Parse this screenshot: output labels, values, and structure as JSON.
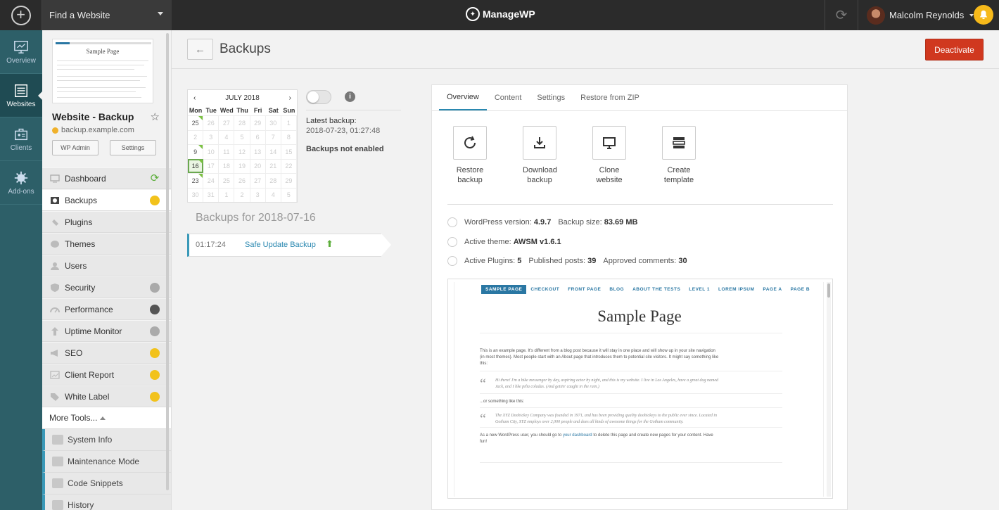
{
  "topbar": {
    "find_website": "Find a Website",
    "logo_text": "ManageWP",
    "user_name": "Malcolm Reynolds"
  },
  "leftnav": [
    {
      "label": "Overview",
      "icon": "monitor-icon"
    },
    {
      "label": "Websites",
      "icon": "websites-icon"
    },
    {
      "label": "Clients",
      "icon": "clients-icon"
    },
    {
      "label": "Add-ons",
      "icon": "addons-icon"
    }
  ],
  "site": {
    "thumb_title": "Sample Page",
    "name": "Website - Backup",
    "url": "backup.example.com",
    "wp_admin": "WP Admin",
    "settings": "Settings"
  },
  "menu": [
    {
      "label": "Dashboard"
    },
    {
      "label": "Backups"
    },
    {
      "label": "Plugins"
    },
    {
      "label": "Themes"
    },
    {
      "label": "Users"
    },
    {
      "label": "Security"
    },
    {
      "label": "Performance"
    },
    {
      "label": "Uptime Monitor"
    },
    {
      "label": "SEO"
    },
    {
      "label": "Client Report"
    },
    {
      "label": "White Label"
    }
  ],
  "more_tools": "More Tools...",
  "submenu": [
    {
      "label": "System Info"
    },
    {
      "label": "Maintenance Mode"
    },
    {
      "label": "Code Snippets"
    },
    {
      "label": "History"
    }
  ],
  "page": {
    "title": "Backups",
    "deactivate": "Deactivate"
  },
  "calendar": {
    "month": "JULY 2018",
    "prev": "‹",
    "next": "›",
    "dows": [
      "Mon",
      "Tue",
      "Wed",
      "Thu",
      "Fri",
      "Sat",
      "Sun"
    ],
    "days": [
      "25",
      "26",
      "27",
      "28",
      "29",
      "30",
      "1",
      "2",
      "3",
      "4",
      "5",
      "6",
      "7",
      "8",
      "9",
      "10",
      "11",
      "12",
      "13",
      "14",
      "15",
      "16",
      "17",
      "18",
      "19",
      "20",
      "21",
      "22",
      "23",
      "24",
      "25",
      "26",
      "27",
      "28",
      "29",
      "30",
      "31",
      "1",
      "2",
      "3",
      "4",
      "5"
    ]
  },
  "latest_backup": {
    "label": "Latest backup:",
    "value": "2018-07-23, 01:27:48",
    "status": "Backups not enabled"
  },
  "backups_for": "Backups for 2018-07-16",
  "backup_entry": {
    "time": "01:17:24",
    "name": "Safe Update Backup"
  },
  "tabs": [
    "Overview",
    "Content",
    "Settings",
    "Restore from ZIP"
  ],
  "actions": [
    {
      "line1": "Restore",
      "line2": "backup"
    },
    {
      "line1": "Download",
      "line2": "backup"
    },
    {
      "line1": "Clone",
      "line2": "website"
    },
    {
      "line1": "Create",
      "line2": "template"
    }
  ],
  "meta": {
    "wp_version_label": "WordPress version:",
    "wp_version": "4.9.7",
    "backup_size_label": "Backup size:",
    "backup_size": "83.69 MB",
    "theme_label": "Active theme:",
    "theme": "AWSM v1.6.1",
    "plugins_label": "Active Plugins:",
    "plugins": "5",
    "posts_label": "Published posts:",
    "posts": "39",
    "comments_label": "Approved comments:",
    "comments": "30"
  },
  "preview": {
    "nav": [
      "SAMPLE PAGE",
      "CHECKOUT",
      "FRONT PAGE",
      "BLOG",
      "ABOUT THE TESTS",
      "LEVEL 1",
      "LOREM IPSUM",
      "PAGE A",
      "PAGE B"
    ],
    "title": "Sample Page",
    "p1": "This is an example page. It's different from a blog post because it will stay in one place and will show up in your site navigation (in most themes). Most people start with an About page that introduces them to potential site visitors. It might say something like this:",
    "q1": "Hi there! I'm a bike messenger by day, aspiring actor by night, and this is my website. I live in Los Angeles, have a great dog named Jack, and I like piña coladas. (And gettin' caught in the rain.)",
    "p2": "...or something like this:",
    "q2": "The XYZ Doohickey Company was founded in 1971, and has been providing quality doohickeys to the public ever since. Located in Gotham City, XYZ employs over 2,000 people and does all kinds of awesome things for the Gotham community.",
    "p3_a": "As a new WordPress user, you should go to ",
    "p3_link": "your dashboard",
    "p3_b": " to delete this page and create new pages for your content. Have fun!"
  }
}
